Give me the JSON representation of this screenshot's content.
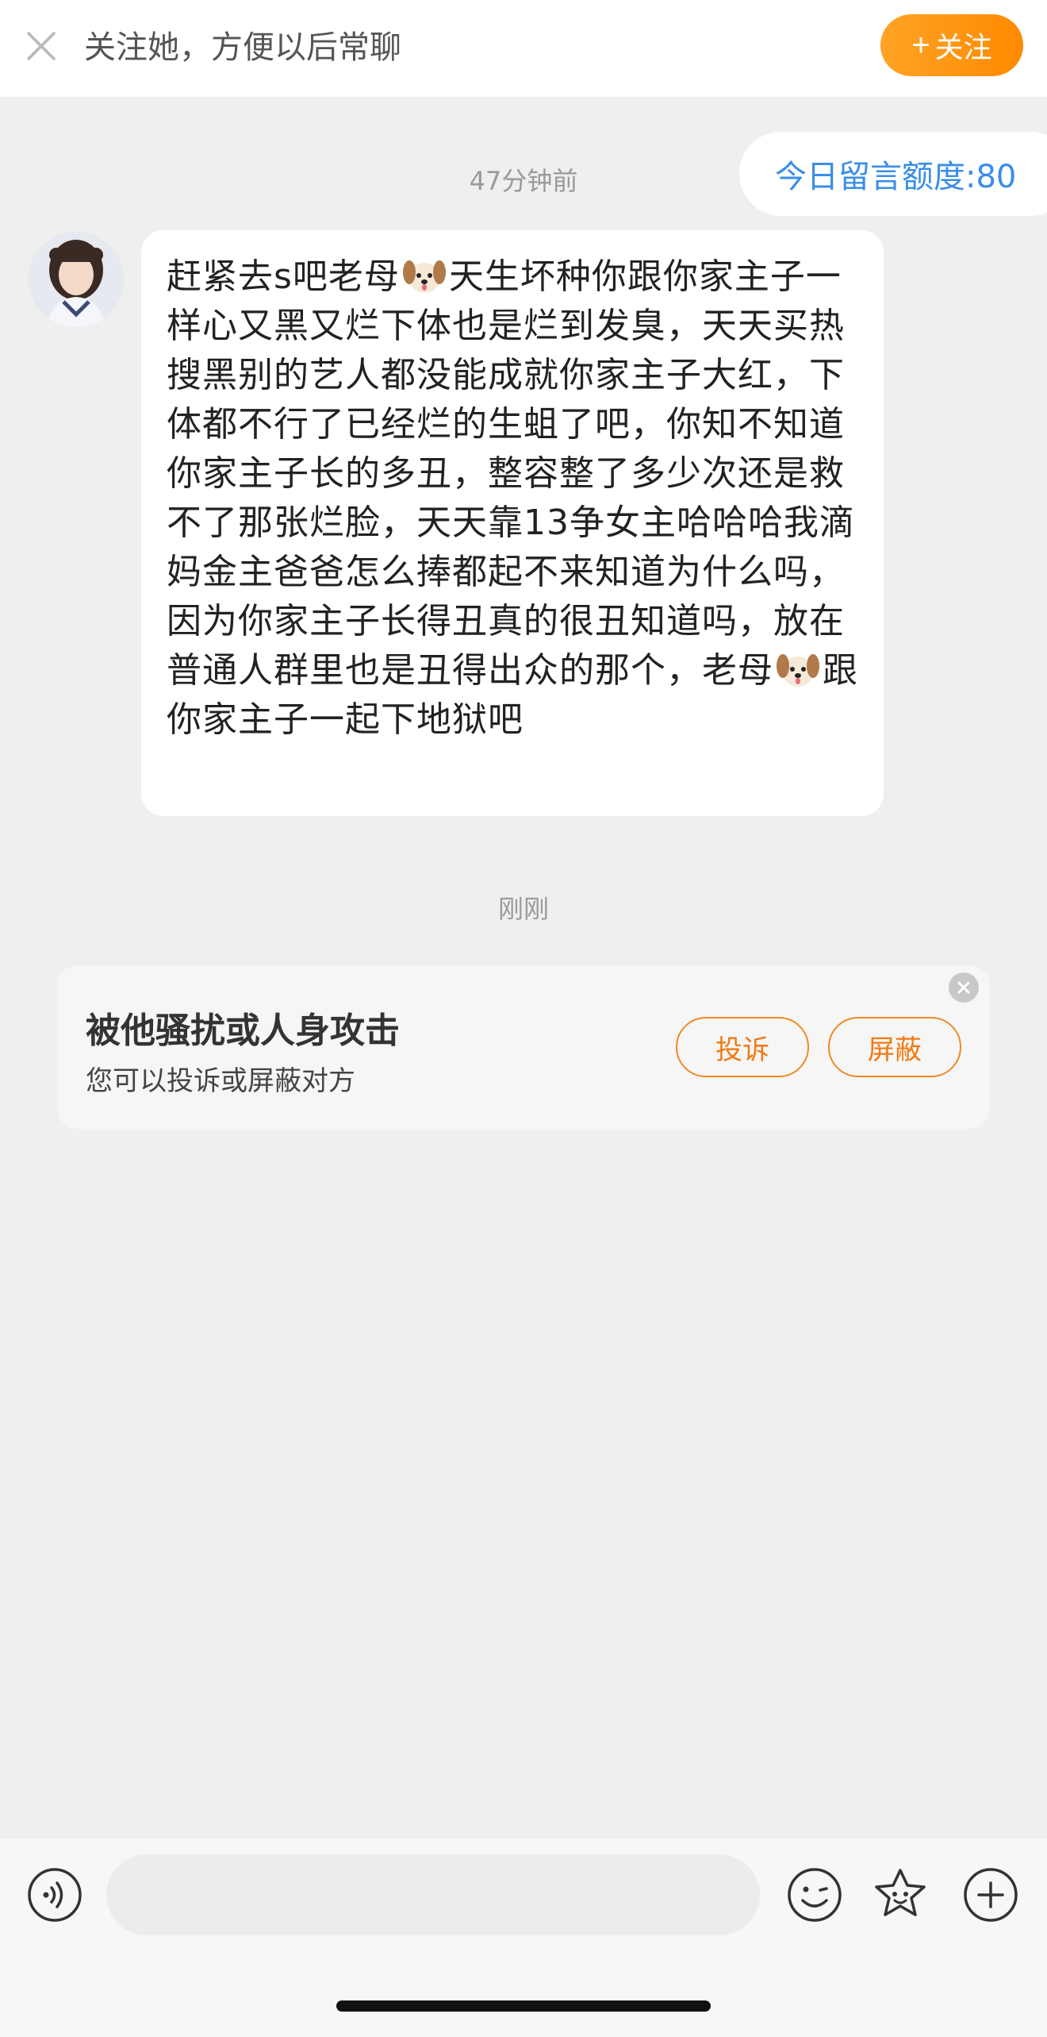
{
  "header": {
    "banner_text": "关注她，方便以后常聊",
    "follow_plus": "+",
    "follow_label": "关注"
  },
  "quota": {
    "label": "今日留言额度:80"
  },
  "messages": [
    {
      "time": "47分钟前",
      "segments": [
        "赶紧去s吧老母",
        "天生坏种你跟你家主子一样心又黑又烂下体也是烂到发臭，天天买热搜黑别的艺人都没能成就你家主子大红，下体都不行了已经烂的生蛆了吧，你知不知道你家主子长的多丑，整容整了多少次还是救不了那张烂脸，天天靠13争女主哈哈哈我滴妈金主爸爸怎么捧都起不来知道为什么吗，因为你家主子长得丑真的很丑知道吗，放在普通人群里也是丑得出众的那个，老母",
        "跟你家主子一起下地狱吧"
      ]
    }
  ],
  "second_time": "刚刚",
  "report_card": {
    "title": "被他骚扰或人身攻击",
    "subtitle": "您可以投诉或屏蔽对方",
    "report_label": "投诉",
    "block_label": "屏蔽"
  },
  "colors": {
    "accent_orange": "#ff8a00",
    "link_blue": "#3a8ee6"
  },
  "icons": {
    "close": "close-icon",
    "dog_emoji": "dog-face-icon",
    "voice": "voice-icon",
    "emoji": "emoji-icon",
    "sticker": "star-sticker-icon",
    "more": "plus-icon"
  }
}
